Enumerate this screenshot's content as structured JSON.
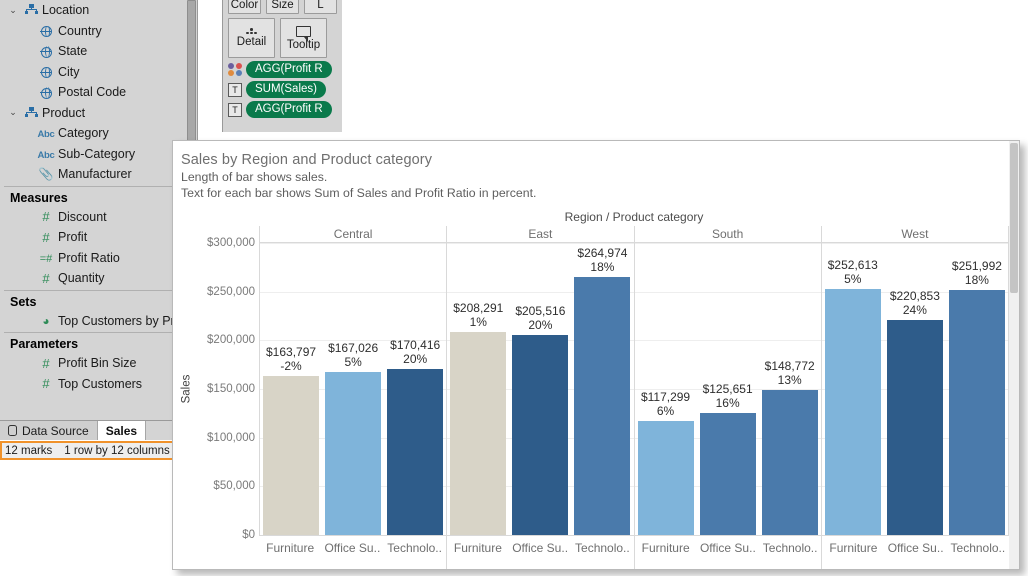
{
  "sidebar": {
    "tree": [
      {
        "label": "Location",
        "type": "hierarchy",
        "caret": "⌄",
        "indent": 0
      },
      {
        "label": "Country",
        "type": "geo",
        "indent": 1
      },
      {
        "label": "State",
        "type": "geo",
        "indent": 1
      },
      {
        "label": "City",
        "type": "geo",
        "indent": 1
      },
      {
        "label": "Postal Code",
        "type": "geo",
        "indent": 1
      },
      {
        "label": "Product",
        "type": "hierarchy",
        "caret": "⌄",
        "indent": 0
      },
      {
        "label": "Category",
        "type": "abc",
        "indent": 1
      },
      {
        "label": "Sub-Category",
        "type": "abc",
        "indent": 1
      },
      {
        "label": "Manufacturer",
        "type": "clip",
        "indent": 1
      }
    ],
    "measures_header": "Measures",
    "measures": [
      {
        "label": "Discount",
        "type": "num"
      },
      {
        "label": "Profit",
        "type": "num"
      },
      {
        "label": "Profit Ratio",
        "type": "calc"
      },
      {
        "label": "Quantity",
        "type": "num"
      }
    ],
    "sets_header": "Sets",
    "sets": [
      {
        "label": "Top Customers by Prof",
        "type": "set"
      }
    ],
    "parameters_header": "Parameters",
    "parameters": [
      {
        "label": "Profit Bin Size",
        "type": "num"
      },
      {
        "label": "Top Customers",
        "type": "num"
      }
    ]
  },
  "tabs": {
    "data_source": "Data Source",
    "sheet": "Sales"
  },
  "status": {
    "marks": "12 marks",
    "dimensions": "1 row by 12 columns"
  },
  "marks_card": {
    "buttons": [
      "Color",
      "Size",
      "L"
    ],
    "detail": "Detail",
    "tooltip": "Tooltip",
    "pills": [
      "AGG(Profit R",
      "SUM(Sales)",
      "AGG(Profit R"
    ]
  },
  "viz": {
    "title": "Sales by Region and Product category",
    "subtitle_line1": "Length of bar shows sales.",
    "subtitle_line2": "Text for each bar shows Sum of Sales and Profit Ratio in percent."
  },
  "chart_data": {
    "type": "bar",
    "title": "Sales by Region and Product category",
    "column_title": "Region / Product category",
    "xlabel": "",
    "ylabel": "Sales",
    "ylim": [
      0,
      300000
    ],
    "yticks": [
      "$0",
      "$50,000",
      "$100,000",
      "$150,000",
      "$200,000",
      "$250,000",
      "$300,000"
    ],
    "ytick_values": [
      0,
      50000,
      100000,
      150000,
      200000,
      250000,
      300000
    ],
    "grid": true,
    "legend": "none",
    "group_labels": [
      "Central",
      "East",
      "South",
      "West"
    ],
    "categories": [
      "Furniture",
      "Office Su..",
      "Technolo.."
    ],
    "groups": [
      {
        "name": "Central",
        "bars": [
          {
            "category": "Furniture",
            "sales": 163797,
            "sales_label": "$163,797",
            "ratio_label": "-2%",
            "color": "#d8d4c7"
          },
          {
            "category": "Office Su..",
            "sales": 167026,
            "sales_label": "$167,026",
            "ratio_label": "5%",
            "color": "#7fb4da"
          },
          {
            "category": "Technolo..",
            "sales": 170416,
            "sales_label": "$170,416",
            "ratio_label": "20%",
            "color": "#2e5c8a"
          }
        ]
      },
      {
        "name": "East",
        "bars": [
          {
            "category": "Furniture",
            "sales": 208291,
            "sales_label": "$208,291",
            "ratio_label": "1%",
            "color": "#d8d4c7"
          },
          {
            "category": "Office Su..",
            "sales": 205516,
            "sales_label": "$205,516",
            "ratio_label": "20%",
            "color": "#2e5c8a"
          },
          {
            "category": "Technolo..",
            "sales": 264974,
            "sales_label": "$264,974",
            "ratio_label": "18%",
            "color": "#4a7aab"
          }
        ]
      },
      {
        "name": "South",
        "bars": [
          {
            "category": "Furniture",
            "sales": 117299,
            "sales_label": "$117,299",
            "ratio_label": "6%",
            "color": "#7fb4da"
          },
          {
            "category": "Office Su..",
            "sales": 125651,
            "sales_label": "$125,651",
            "ratio_label": "16%",
            "color": "#4a7aab"
          },
          {
            "category": "Technolo..",
            "sales": 148772,
            "sales_label": "$148,772",
            "ratio_label": "13%",
            "color": "#4a7aab"
          }
        ]
      },
      {
        "name": "West",
        "bars": [
          {
            "category": "Furniture",
            "sales": 252613,
            "sales_label": "$252,613",
            "ratio_label": "5%",
            "color": "#7fb4da"
          },
          {
            "category": "Office Su..",
            "sales": 220853,
            "sales_label": "$220,853",
            "ratio_label": "24%",
            "color": "#2e5c8a"
          },
          {
            "category": "Technolo..",
            "sales": 251992,
            "sales_label": "$251,992",
            "ratio_label": "18%",
            "color": "#4a7aab"
          }
        ]
      }
    ]
  },
  "colors": {
    "beige": "#d8d4c7",
    "light_blue": "#7fb4da",
    "medium_blue": "#4a7aab",
    "dark_blue": "#2e5c8a",
    "pill_green": "#0a7a4b",
    "highlight_orange": "#f0922b"
  }
}
